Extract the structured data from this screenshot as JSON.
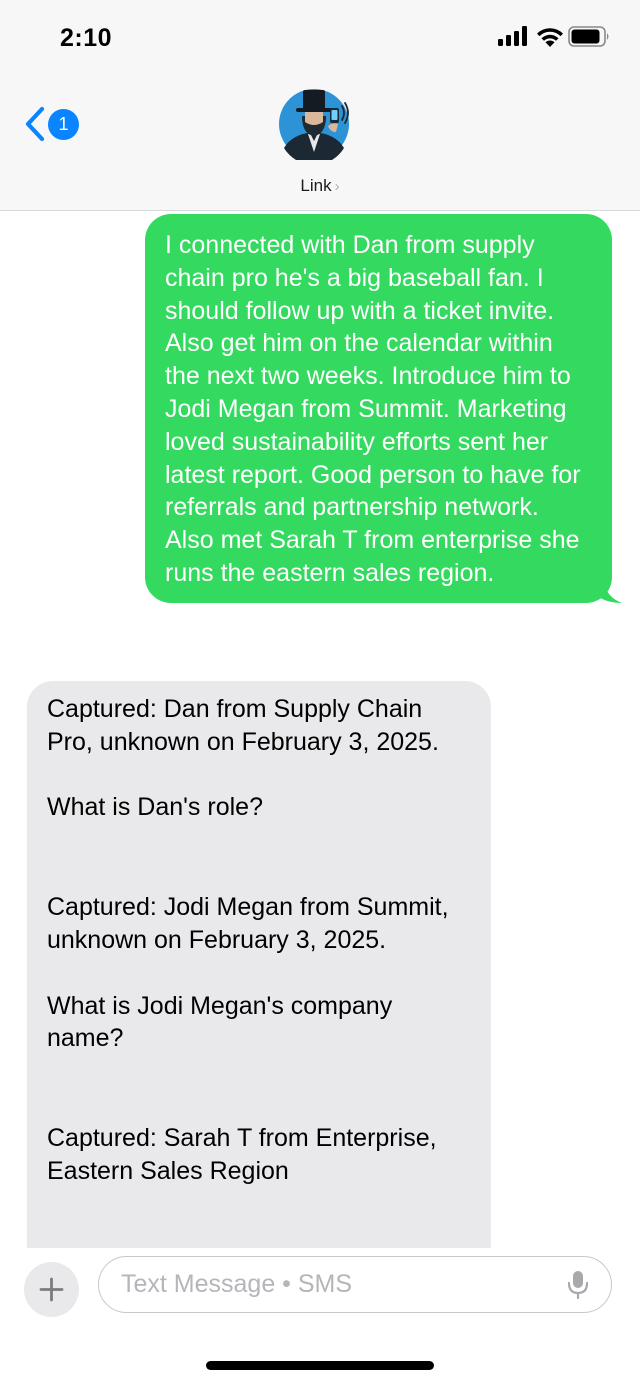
{
  "status_bar": {
    "time": "2:10"
  },
  "header": {
    "back_badge_count": "1",
    "contact_name": "Link",
    "chevron": "›"
  },
  "messages": {
    "outgoing_1": "I connected with Dan from supply chain pro he's a big baseball fan. I should follow up with a ticket invite. Also get him on the calendar within the next two weeks. Introduce him to Jodi Megan from Summit. Marketing loved sustainability efforts sent her latest report. Good person to have for referrals and partnership network. Also met Sarah T from enterprise she runs the eastern sales region.",
    "incoming_1": {
      "capture_1": "Captured: Dan from Supply Chain Pro, unknown on February 3, 2025.",
      "question_1": "What is Dan's role?",
      "capture_2": "Captured: Jodi Megan from Summit, unknown on February 3, 2025.",
      "question_2": "What is Jodi Megan's company name?",
      "capture_3": "Captured: Sarah T from Enterprise, Eastern Sales Region"
    }
  },
  "composer": {
    "placeholder": "Text Message • SMS"
  },
  "icons": {
    "back": "chevron-left-icon",
    "plus": "plus-icon",
    "mic": "microphone-icon",
    "signal": "cellular-signal-icon",
    "wifi": "wifi-icon",
    "battery": "battery-icon"
  },
  "colors": {
    "accent_blue": "#0a84ff",
    "outgoing_bubble": "#34da5f",
    "incoming_bubble": "#e9e9eb",
    "header_bg": "#f7f7f7"
  }
}
